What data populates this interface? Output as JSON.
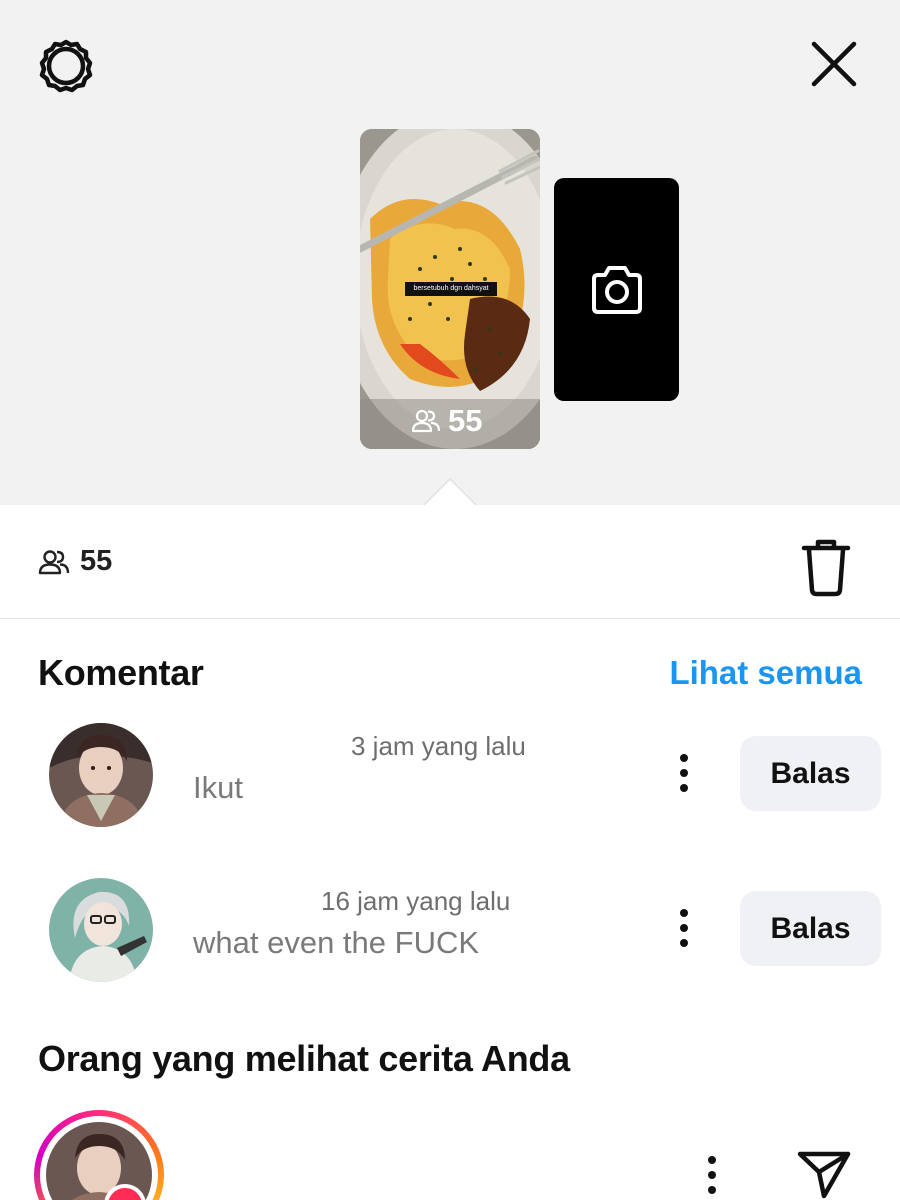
{
  "header": {
    "settings_icon": "settings-gear-icon",
    "close_icon": "close-icon"
  },
  "story": {
    "caption": "bersetubuh dgn dahsyat",
    "viewers": "55",
    "add_icon": "camera-icon"
  },
  "stats": {
    "viewers": "55",
    "viewers_icon": "people-icon",
    "delete_icon": "trash-icon"
  },
  "comments": {
    "title": "Komentar",
    "see_all": "Lihat semua",
    "items": [
      {
        "time": "3 jam yang lalu",
        "text": "Ikut",
        "reply": "Balas"
      },
      {
        "time": "16 jam yang lalu",
        "text": "what even the FUCK",
        "reply": "Balas"
      }
    ]
  },
  "viewers_section": {
    "title": "Orang yang melihat cerita Anda",
    "send_icon": "send-icon"
  },
  "colors": {
    "accent": "#1a95f0",
    "top_bg": "#f2f2f2",
    "reply_bg": "#eff1f5"
  }
}
